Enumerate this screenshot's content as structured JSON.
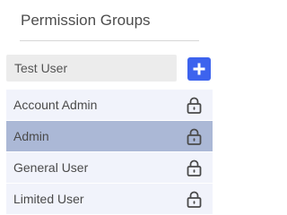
{
  "panel": {
    "title": "Permission Groups"
  },
  "search": {
    "value": "Test User",
    "placeholder": ""
  },
  "add_button": {
    "icon": "plus-icon",
    "color": "#3d63ee"
  },
  "groups": [
    {
      "label": "Account Admin",
      "icon": "lock-icon",
      "selected": false
    },
    {
      "label": "Admin",
      "icon": "lock-icon",
      "selected": true
    },
    {
      "label": "General User",
      "icon": "lock-icon",
      "selected": false
    },
    {
      "label": "Limited User",
      "icon": "lock-icon",
      "selected": false
    }
  ],
  "colors": {
    "row_background": "#f1f3fb",
    "row_selected_background": "#abb8d6",
    "input_background": "#ececec"
  }
}
